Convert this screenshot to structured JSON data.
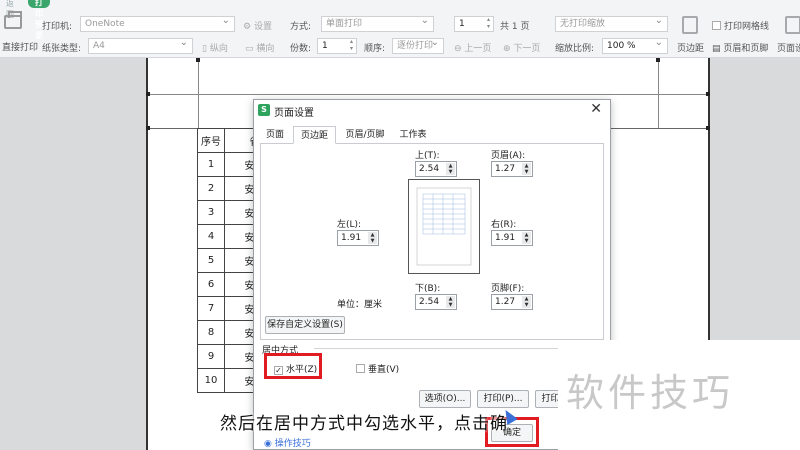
{
  "toolbar": {
    "back_tab": "返回",
    "active_tab": "打印预览",
    "direct_print": "直接打印",
    "printer_label": "打印机:",
    "printer_value": "OneNote",
    "settings": "设置",
    "paper_label": "纸张类型:",
    "paper_value": "A4",
    "portrait": "纵向",
    "landscape": "横向",
    "mode_label": "方式:",
    "mode_value": "单面打印",
    "copies_label": "份数:",
    "copies_value": "1",
    "order_label": "顺序:",
    "order_value": "逐份打印",
    "page_value": "1",
    "page_total": "共 1 页",
    "prev_page": "上一页",
    "next_page": "下一页",
    "scale_value": "无打印缩放",
    "zoom_label": "缩放比例:",
    "zoom_value": "100 %",
    "print_gridlines": "打印网格线",
    "margins": "页边距",
    "header_footer": "页眉和页脚",
    "page_setup": "页面设"
  },
  "table": {
    "header": [
      "序号",
      "省"
    ],
    "rows": [
      [
        "1",
        "安徽"
      ],
      [
        "2",
        "安徽"
      ],
      [
        "3",
        "安徽"
      ],
      [
        "4",
        "安徽"
      ],
      [
        "5",
        "安徽"
      ],
      [
        "6",
        "安徽"
      ],
      [
        "7",
        "安徽"
      ],
      [
        "8",
        "安徽"
      ],
      [
        "9",
        "安徽"
      ],
      [
        "10",
        "安徽"
      ]
    ]
  },
  "dialog": {
    "logo": "S",
    "title": "页面设置",
    "tabs": [
      "页面",
      "页边距",
      "页眉/页脚",
      "工作表"
    ],
    "top_label": "上(T):",
    "top_value": "2.54",
    "header_label": "页眉(A):",
    "header_value": "1.27",
    "left_label": "左(L):",
    "left_value": "1.91",
    "right_label": "右(R):",
    "right_value": "1.91",
    "bottom_label": "下(B):",
    "bottom_value": "2.54",
    "footer_label": "页脚(F):",
    "footer_value": "1.27",
    "unit_text": "单位：厘米",
    "save_custom": "保存自定义设置(S)",
    "center_section": "居中方式",
    "horizontal": "水平(Z)",
    "vertical": "垂直(V)",
    "options_button": "选项(O)...",
    "print_button": "打印(P)...",
    "print_preview_button": "打印预",
    "ok_button": "确定",
    "tips": "操作技巧"
  },
  "subtitle": "然后在居中方式中勾选水平，点击确",
  "watermark": "软件技巧"
}
